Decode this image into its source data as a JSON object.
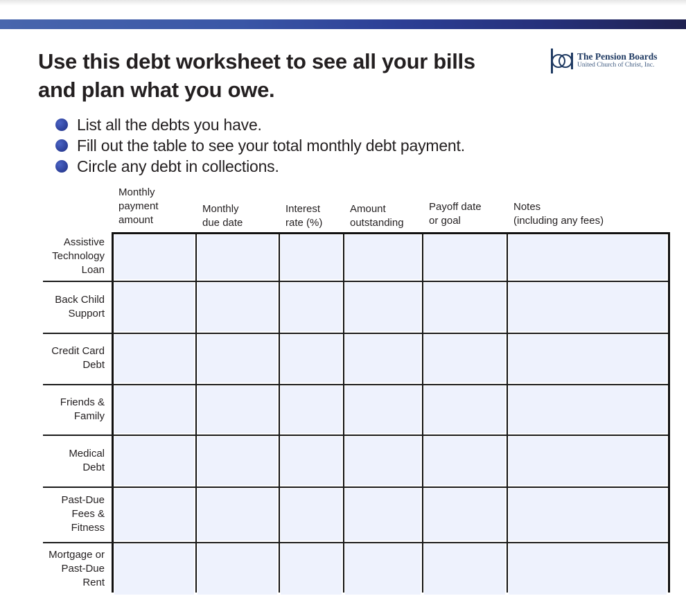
{
  "header": {
    "title_line1": "Use this debt worksheet to see all your bills",
    "title_line2": "and plan what you owe.",
    "logo": {
      "icon": "pension-boards-monogram-icon",
      "name": "The Pension Boards",
      "subtitle": "United Church of Christ, Inc."
    }
  },
  "instructions": [
    "List all the debts you have.",
    "Fill out the table to see your total monthly debt payment.",
    "Circle any debt in collections."
  ],
  "colors": {
    "banner_start": "#4866ad",
    "banner_end": "#1f2150",
    "bullet": "#2b3e97",
    "cell_fill": "#eef2fd",
    "logo_text": "#1f3a62"
  },
  "table": {
    "columns": [
      {
        "key": "monthly_payment",
        "label_lines": [
          "Monthly",
          "payment",
          "amount"
        ]
      },
      {
        "key": "due_date",
        "label_lines": [
          "Monthly",
          "due date"
        ]
      },
      {
        "key": "interest_rate",
        "label_lines": [
          "Interest",
          "rate (%)"
        ]
      },
      {
        "key": "amount_outstanding",
        "label_lines": [
          "Amount",
          "outstanding"
        ]
      },
      {
        "key": "payoff",
        "label_lines": [
          "Payoff date",
          "or goal"
        ]
      },
      {
        "key": "notes",
        "label_lines": [
          "Notes",
          "(including any fees)"
        ]
      }
    ],
    "rows": [
      {
        "label_lines": [
          "Assistive",
          "Technology",
          "Loan"
        ],
        "values": [
          "",
          "",
          "",
          "",
          "",
          ""
        ]
      },
      {
        "label_lines": [
          "Back Child",
          "Support"
        ],
        "values": [
          "",
          "",
          "",
          "",
          "",
          ""
        ]
      },
      {
        "label_lines": [
          "Credit Card",
          "Debt"
        ],
        "values": [
          "",
          "",
          "",
          "",
          "",
          ""
        ]
      },
      {
        "label_lines": [
          "Friends &",
          "Family"
        ],
        "values": [
          "",
          "",
          "",
          "",
          "",
          ""
        ]
      },
      {
        "label_lines": [
          "Medical",
          "Debt"
        ],
        "values": [
          "",
          "",
          "",
          "",
          "",
          ""
        ]
      },
      {
        "label_lines": [
          "Past-Due",
          "Fees &",
          "Fitness"
        ],
        "values": [
          "",
          "",
          "",
          "",
          "",
          ""
        ]
      },
      {
        "label_lines": [
          "Mortgage or",
          "Past-Due",
          "Rent"
        ],
        "values": [
          "",
          "",
          "",
          "",
          "",
          ""
        ]
      }
    ]
  }
}
